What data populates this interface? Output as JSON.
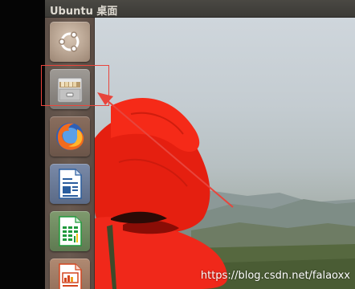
{
  "panel": {
    "title": "Ubuntu 桌面"
  },
  "launcher": {
    "items": [
      {
        "icon": "ubuntu-logo-icon",
        "color": "#c8b7a6"
      },
      {
        "icon": "file-cabinet-icon",
        "color": "#cfcfcf"
      },
      {
        "icon": "firefox-icon",
        "color": "#e66000"
      },
      {
        "icon": "writer-document-icon",
        "color": "#2a5d9e"
      },
      {
        "icon": "calc-spreadsheet-icon",
        "color": "#1f9a3c"
      },
      {
        "icon": "impress-presentation-icon",
        "color": "#d4451e"
      }
    ]
  },
  "annotation": {
    "color": "#e8453c"
  },
  "watermark": {
    "text": "https://blog.csdn.net/falaoxx"
  }
}
